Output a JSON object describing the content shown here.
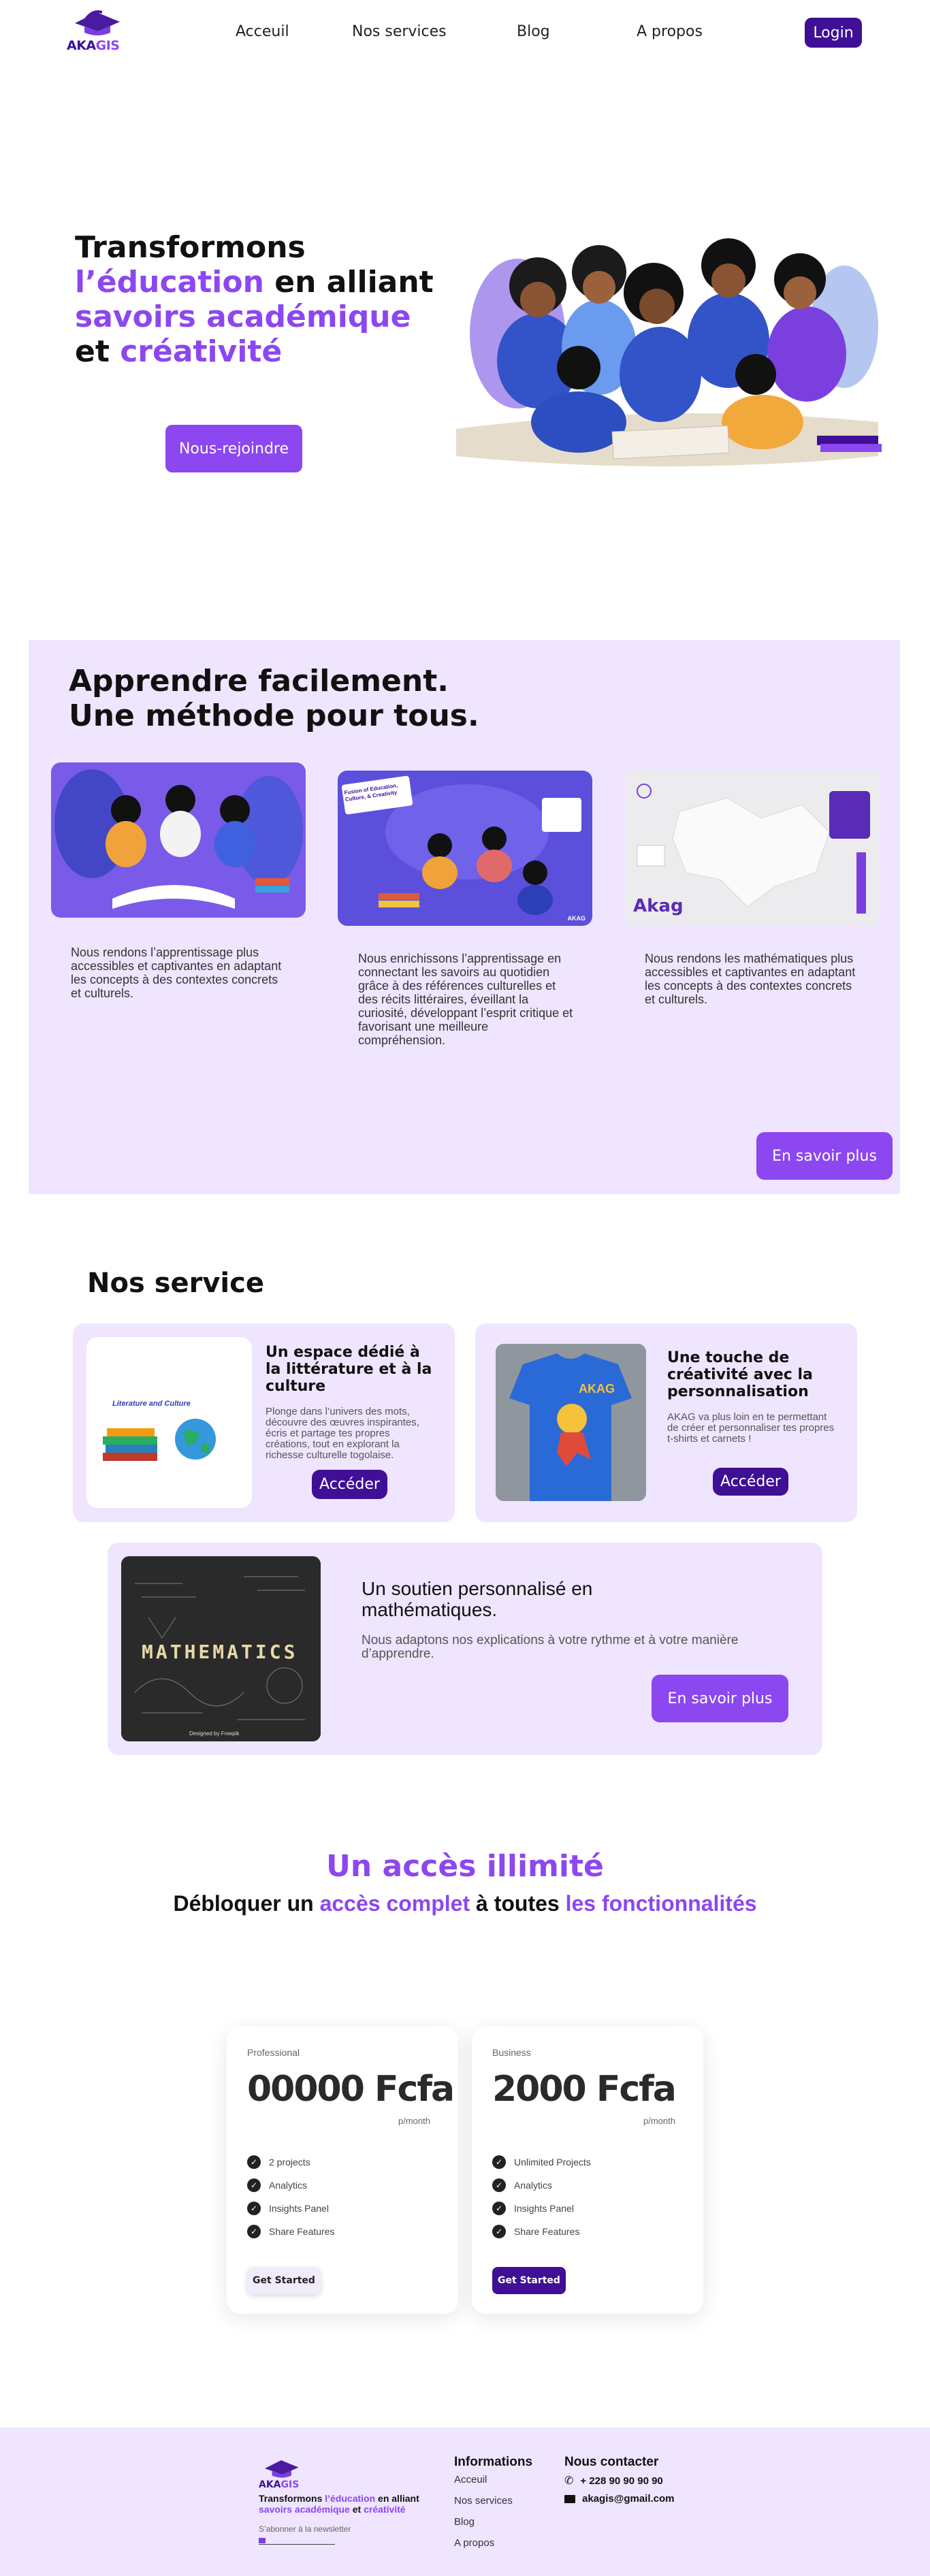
{
  "brand": {
    "name": "AKAGIS",
    "name_prefix": "AKA",
    "name_suffix": "GIS"
  },
  "nav": {
    "items": [
      {
        "label": "Acceuil"
      },
      {
        "label": "Nos services"
      },
      {
        "label": "Blog"
      },
      {
        "label": "A propos"
      }
    ],
    "login_label": "Login"
  },
  "hero": {
    "line1": "Transformons",
    "line2_accent": "l’éducation",
    "line2_rest": " en alliant",
    "line3_accent": "savoirs académique",
    "line4_prefix": "et ",
    "line4_accent": "créativité",
    "cta_label": "Nous-rejoindre"
  },
  "methods": {
    "title_line1": "Apprendre facilement.",
    "title_line2": "Une méthode pour tous.",
    "cards": [
      {
        "text": "Nous rendons l’apprentissage plus accessibles et captivantes en adaptant les concepts à des contextes concrets et culturels."
      },
      {
        "image_caption": "Fusion of Education, Culture, & Creativity",
        "image_badge": "AKAG",
        "text": "Nous enrichissons l’apprentissage en connectant les savoirs au quotidien grâce à des références culturelles et des récits littéraires, éveillant la curiosité, développant l’esprit critique et favorisant une meilleure compréhension."
      },
      {
        "image_logo": "Akag",
        "text": "Nous rendons les mathématiques  plus accessibles et captivantes en adaptant les concepts à des contextes concrets et culturels."
      }
    ],
    "more_label": "En savoir plus"
  },
  "services": {
    "title": "Nos service",
    "items": [
      {
        "image_label": "Literature and Culture",
        "heading": "Un espace dédié à la littérature et à la culture",
        "text": "Plonge dans l’univers des mots, découvre des œuvres inspirantes, écris et partage tes propres créations, tout en explorant la richesse culturelle togolaise.",
        "button": "Accéder"
      },
      {
        "image_label": "AKAG",
        "heading": "Une touche de créativité avec la personnalisation",
        "text": "AKAG va plus loin en te permettant de créer et personnaliser tes propres t-shirts et carnets !",
        "button": "Accéder"
      },
      {
        "image_label": "MATHEMATICS",
        "image_credit": "Designed by Freepik",
        "heading": "Un soutien personnalisé en mathématiques.",
        "text": "Nous adaptons nos explications à votre rythme et à votre manière d’apprendre.",
        "button": "En savoir plus"
      }
    ]
  },
  "access": {
    "title": "Un accès illimité",
    "sub_1": "Débloquer un ",
    "sub_2": "accès complet",
    "sub_3": " à toutes ",
    "sub_4": "les fonctionnalités"
  },
  "pricing": {
    "plans": [
      {
        "name": "Professional",
        "price": "00000 Fcfa",
        "period": "p/month",
        "features": [
          "2 projects",
          "Analytics",
          "Insights Panel",
          "Share Features"
        ],
        "cta": "Get Started"
      },
      {
        "name": "Business",
        "price": "2000 Fcfa",
        "period": "p/month",
        "features": [
          "Unlimited Projects",
          "Analytics",
          "Insights Panel",
          "Share Features"
        ],
        "cta": "Get Started"
      }
    ]
  },
  "footer": {
    "tagline_1": "Transformons ",
    "tagline_2": "l’éducation",
    "tagline_3": " en alliant",
    "tagline_4": "savoirs académique",
    "tagline_5": " et ",
    "tagline_6": "créativité",
    "newsletter_label": "S’abonner à la newsletter",
    "info_title": "Informations",
    "info_links": [
      "Acceuil",
      "Nos services",
      "Blog",
      "A propos"
    ],
    "contact_title": "Nous contacter",
    "phone": "+ 228 90 90 90 90",
    "email": "akagis@gmail.com"
  },
  "colors": {
    "accent": "#8c47f0",
    "dark_accent": "#3f0f95",
    "section_bg": "#efe5ff"
  },
  "icons": [
    "graduation-cap-icon",
    "check-icon",
    "phone-icon",
    "mail-icon"
  ]
}
